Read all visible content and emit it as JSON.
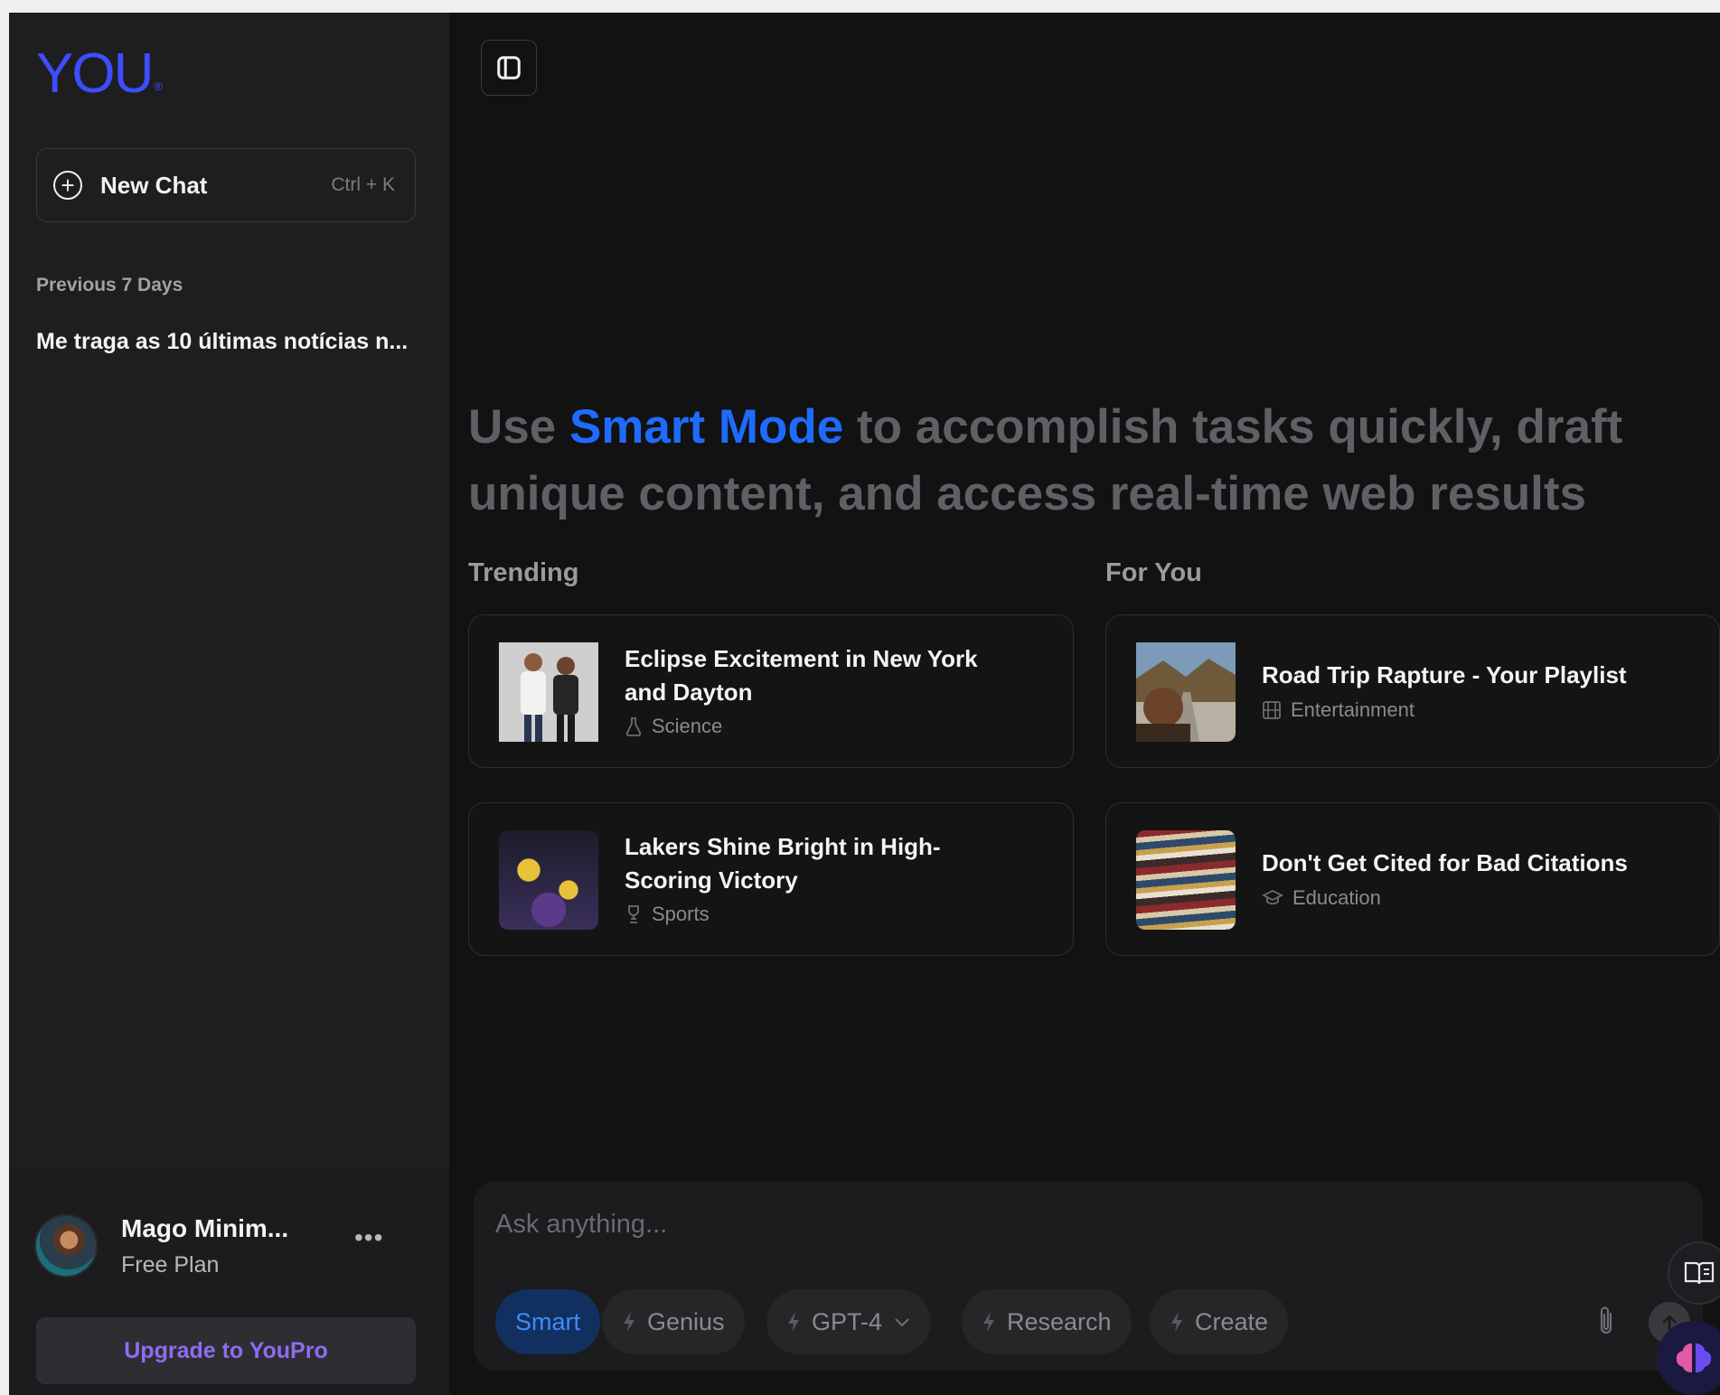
{
  "sidebar": {
    "logo": "YOU",
    "new_chat_label": "New Chat",
    "new_chat_shortcut": "Ctrl + K",
    "section_label": "Previous 7 Days",
    "history": [
      "Me traga as 10 últimas notícias n..."
    ],
    "profile": {
      "name": "Mago Minim...",
      "plan": "Free Plan",
      "more": "•••",
      "upgrade_label": "Upgrade to YouPro"
    }
  },
  "main": {
    "headline_prefix": "Use ",
    "headline_accent": "Smart Mode",
    "headline_suffix": " to accomplish tasks quickly, draft unique content, and access real-time web results",
    "trending_label": "Trending",
    "foryou_label": "For You",
    "cards": [
      {
        "title": "Eclipse Excitement in New York and Dayton",
        "category": "Science",
        "icon": "flask-icon"
      },
      {
        "title": "Road Trip Rapture - Your Playlist",
        "category": "Entertainment",
        "icon": "film-icon"
      },
      {
        "title": "Lakers Shine Bright in High-Scoring Victory",
        "category": "Sports",
        "icon": "trophy-icon"
      },
      {
        "title": "Don't Get Cited for Bad Citations",
        "category": "Education",
        "icon": "graduation-cap-icon"
      }
    ]
  },
  "composer": {
    "placeholder": "Ask anything...",
    "modes": [
      "Smart",
      "Genius",
      "GPT-4",
      "Research",
      "Create"
    ],
    "active_mode": "Smart"
  },
  "colors": {
    "accent": "#1f6bff",
    "logo": "#3d4dff",
    "upgrade": "#8e6cf0",
    "background": "#121212",
    "sidebar": "#1e1e20"
  }
}
